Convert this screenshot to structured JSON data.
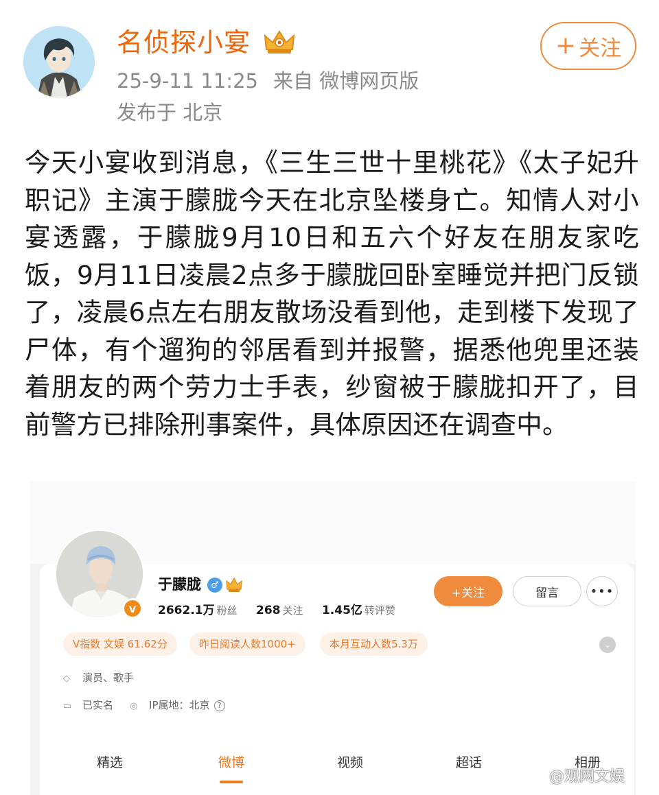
{
  "post": {
    "author": "名侦探小宴",
    "timestamp": "25-9-11 11:25",
    "source": "来自 微博网页版",
    "location": "发布于 北京",
    "follow_label": "关注",
    "follow_plus": "+",
    "text": "今天小宴收到消息，《三生三世十里桃花》《太子妃升职记》主演于朦胧今天在北京坠楼身亡。知情人对小宴透露，于朦胧9月10日和五六个好友在朋友家吃饭，9月11日凌晨2点多于朦胧回卧室睡觉并把门反锁了，凌晨6点左右朋友散场没看到他，走到楼下发现了尸体，有个遛狗的邻居看到并报警，据悉他兜里还装着朋友的两个劳力士手表，纱窗被于朦胧扣开了，目前警方已排除刑事案件，具体原因还在调查中。"
  },
  "profile": {
    "name": "于朦胧",
    "verified_mark": "v",
    "stats": [
      {
        "value": "2662.1万",
        "label": "粉丝"
      },
      {
        "value": "268",
        "label": "关注"
      },
      {
        "value": "1.45亿",
        "label": "转评赞"
      }
    ],
    "follow_label": "+关注",
    "message_label": "留言",
    "more_label": "•••",
    "pills": [
      "V指数 文娱 61.62分",
      "昨日阅读人数1000+",
      "本月互动人数5.3万"
    ],
    "occupation": "演员、歌手",
    "real_name_status": "已实名",
    "ip_location": "IP属地：北京",
    "tabs": [
      "精选",
      "微博",
      "视频",
      "超话",
      "相册"
    ],
    "active_tab": "微博"
  },
  "watermark": "@观网文娱",
  "colors": {
    "accent_orange": "#f08a3c",
    "author_name": "#f0640a",
    "meta_gray": "#8a8a8a",
    "pill_bg": "#fdf0e6",
    "pill_text": "#ea7a2e"
  }
}
